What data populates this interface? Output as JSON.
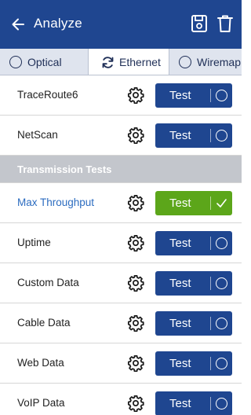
{
  "header": {
    "title": "Analyze",
    "icons": [
      "arrow-left-icon",
      "save-icon",
      "trash-icon"
    ]
  },
  "tabs": [
    {
      "label": "Optical",
      "icon": "radio-icon",
      "active": false
    },
    {
      "label": "Ethernet",
      "icon": "refresh-icon",
      "active": true
    },
    {
      "label": "Wiremap",
      "icon": "radio-icon",
      "active": false
    }
  ],
  "rows_top": [
    {
      "label": "TraceRoute6",
      "button": "Test",
      "status": "idle"
    },
    {
      "label": "NetScan",
      "button": "Test",
      "status": "idle"
    }
  ],
  "section": {
    "label": "Transmission Tests"
  },
  "rows_bottom": [
    {
      "label": "Max Throughput",
      "button": "Test",
      "status": "passed",
      "highlight": true
    },
    {
      "label": "Uptime",
      "button": "Test",
      "status": "idle"
    },
    {
      "label": "Custom Data",
      "button": "Test",
      "status": "idle"
    },
    {
      "label": "Cable Data",
      "button": "Test",
      "status": "idle"
    },
    {
      "label": "Web Data",
      "button": "Test",
      "status": "idle"
    },
    {
      "label": "VoIP Data",
      "button": "Test",
      "status": "idle"
    }
  ],
  "colors": {
    "header": "#1f4690",
    "button_idle": "#1f4690",
    "button_passed": "#5ca61a",
    "section_bg": "#c3c6cc",
    "highlight_text": "#2c6cc0"
  }
}
